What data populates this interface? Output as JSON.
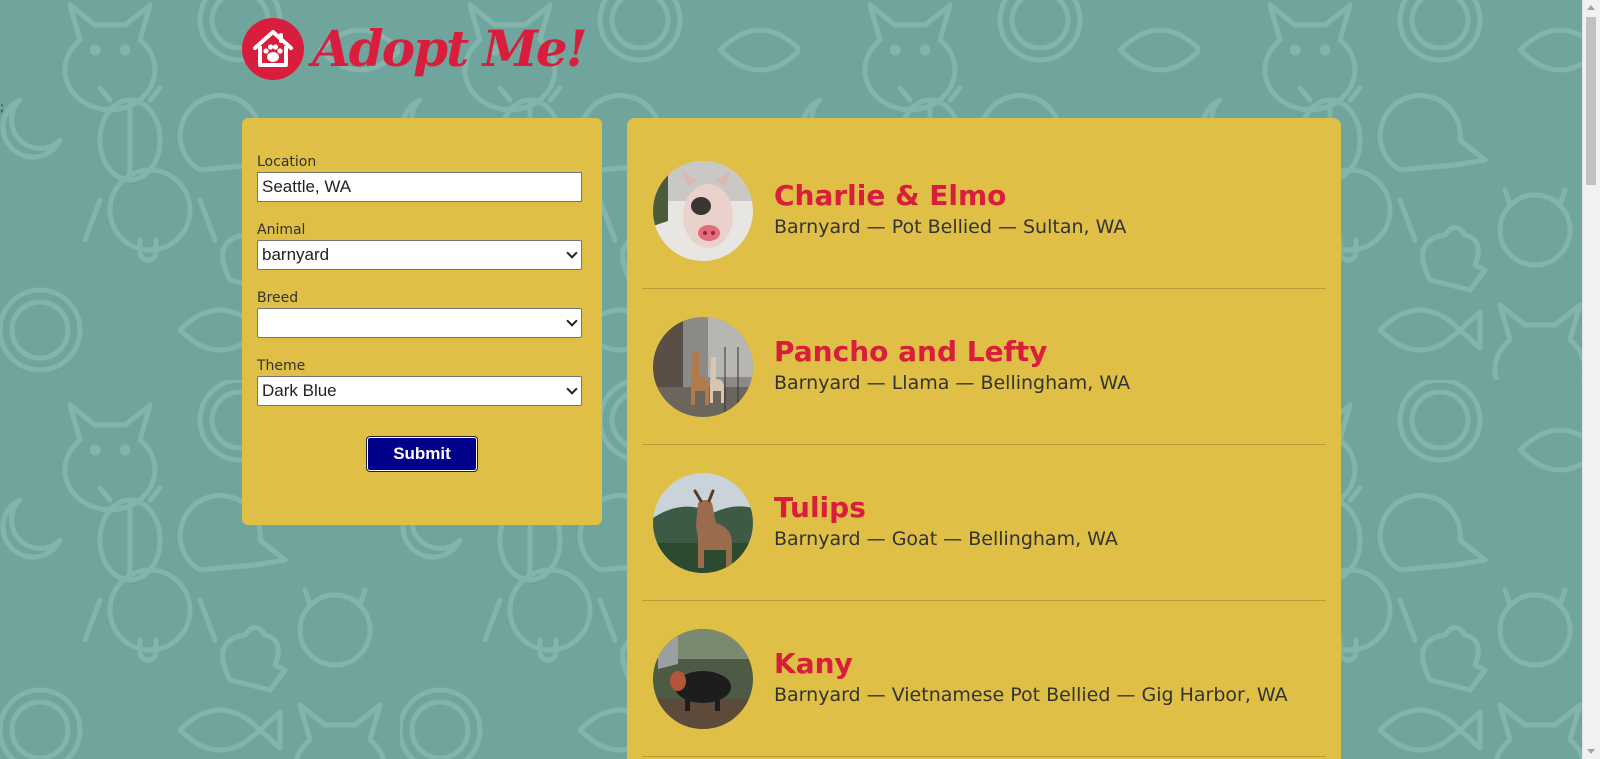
{
  "colors": {
    "background": "#6fa59c",
    "panel": "#dfbf45",
    "brand_red": "#d81e3c",
    "button": "#00008b"
  },
  "stray_text": ";",
  "header": {
    "title": "Adopt Me!",
    "logo_icon": "house-paw-icon"
  },
  "form": {
    "location": {
      "label": "Location",
      "value": "Seattle, WA"
    },
    "animal": {
      "label": "Animal",
      "value": "barnyard"
    },
    "breed": {
      "label": "Breed",
      "value": ""
    },
    "theme": {
      "label": "Theme",
      "value": "Dark Blue"
    },
    "submit_label": "Submit"
  },
  "pets": [
    {
      "name": "Charlie & Elmo",
      "desc": "Barnyard — Pot Bellied — Sultan, WA",
      "photo": "pig-photo"
    },
    {
      "name": "Pancho and Lefty",
      "desc": "Barnyard — Llama — Bellingham, WA",
      "photo": "llama-photo"
    },
    {
      "name": "Tulips",
      "desc": "Barnyard — Goat — Bellingham, WA",
      "photo": "goat-photo"
    },
    {
      "name": "Kany",
      "desc": "Barnyard — Vietnamese Pot Bellied — Gig Harbor, WA",
      "photo": "black-pig-photo"
    }
  ]
}
